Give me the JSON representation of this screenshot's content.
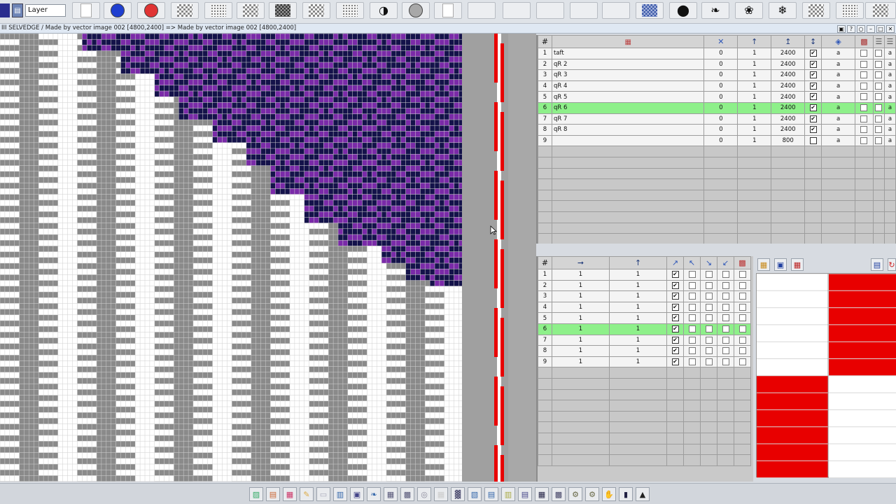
{
  "toolbar": {
    "layer_label": "Layer",
    "buttons": [
      {
        "icon": "blank-page-icon"
      },
      {
        "icon": "blue-circle-icon",
        "color": "#1f3fd0"
      },
      {
        "icon": "red-circle-icon",
        "color": "#e03434"
      },
      {
        "icon": "pattern-grid-icon"
      },
      {
        "icon": "pattern-dots-icon"
      },
      {
        "icon": "pattern-lattice-icon"
      },
      {
        "icon": "pattern-dark-icon"
      },
      {
        "icon": "pattern-weave-icon"
      },
      {
        "icon": "pattern-fine-icon"
      },
      {
        "icon": "pattern-swirl-icon"
      },
      {
        "icon": "gray-circle-icon",
        "color": "#a8a8a8"
      },
      {
        "icon": "blank-swatch-icon"
      },
      {
        "icon": "empty-slot-icon"
      },
      {
        "icon": "empty-slot-icon"
      },
      {
        "icon": "empty-slot-icon"
      },
      {
        "icon": "empty-slot-icon"
      },
      {
        "icon": "empty-slot-icon"
      },
      {
        "icon": "pattern-blue-icon"
      },
      {
        "icon": "black-blob-icon"
      },
      {
        "icon": "butterfly-icon"
      },
      {
        "icon": "flower-icon"
      },
      {
        "icon": "snowflake-icon"
      },
      {
        "icon": "pattern-checker-icon"
      },
      {
        "icon": "pattern-lace-icon"
      },
      {
        "icon": "pattern-ring-icon"
      }
    ]
  },
  "titlebar": {
    "text": "III  SELVEDGE / Made by vector image 002 [4800,2400] => Made by vector image 002 [4800,2400]"
  },
  "colors": {
    "purple": "#7a2aa8",
    "navy": "#14124a",
    "gray": "#8a8a8a",
    "white": "#ffffff",
    "red": "#e80000",
    "selected_row": "#8ef08a"
  },
  "yarn_table": {
    "headers": {
      "num": "#"
    },
    "rows": [
      {
        "num": "1",
        "name": "taft",
        "c1": "0",
        "c2": "1",
        "c3": "2400",
        "checked": true,
        "a": "a",
        "b": "a"
      },
      {
        "num": "2",
        "name": "qR 2",
        "c1": "0",
        "c2": "1",
        "c3": "2400",
        "checked": true,
        "a": "a",
        "b": "a"
      },
      {
        "num": "3",
        "name": "qR 3",
        "c1": "0",
        "c2": "1",
        "c3": "2400",
        "checked": true,
        "a": "a",
        "b": "a"
      },
      {
        "num": "4",
        "name": "qR 4",
        "c1": "0",
        "c2": "1",
        "c3": "2400",
        "checked": true,
        "a": "a",
        "b": "a"
      },
      {
        "num": "5",
        "name": "qR 5",
        "c1": "0",
        "c2": "1",
        "c3": "2400",
        "checked": true,
        "a": "a",
        "b": "a"
      },
      {
        "num": "6",
        "name": "qR 6",
        "c1": "0",
        "c2": "1",
        "c3": "2400",
        "checked": true,
        "a": "a",
        "b": "a",
        "selected": true
      },
      {
        "num": "7",
        "name": "qR 7",
        "c1": "0",
        "c2": "1",
        "c3": "2400",
        "checked": true,
        "a": "a",
        "b": "a"
      },
      {
        "num": "8",
        "name": "qR 8",
        "c1": "0",
        "c2": "1",
        "c3": "2400",
        "checked": true,
        "a": "a",
        "b": "a"
      },
      {
        "num": "9",
        "name": "",
        "c1": "0",
        "c2": "1",
        "c3": "800",
        "checked": false,
        "a": "a",
        "b": "a"
      }
    ]
  },
  "order_table": {
    "headers": {
      "num": "#"
    },
    "rows": [
      {
        "num": "1",
        "c1": "1",
        "c2": "1",
        "checked": true
      },
      {
        "num": "2",
        "c1": "1",
        "c2": "1",
        "checked": true
      },
      {
        "num": "3",
        "c1": "1",
        "c2": "1",
        "checked": true
      },
      {
        "num": "4",
        "c1": "1",
        "c2": "1",
        "checked": true
      },
      {
        "num": "5",
        "c1": "1",
        "c2": "1",
        "checked": true
      },
      {
        "num": "6",
        "c1": "1",
        "c2": "1",
        "checked": true,
        "selected": true
      },
      {
        "num": "7",
        "c1": "1",
        "c2": "1",
        "checked": true
      },
      {
        "num": "8",
        "c1": "1",
        "c2": "1",
        "checked": true
      },
      {
        "num": "9",
        "c1": "1",
        "c2": "1",
        "checked": true
      }
    ]
  },
  "bottom_tools": [
    "layer-icon",
    "color-bars-icon",
    "grid-color-icon",
    "pencil-icon",
    "eraser-icon",
    "split-icon",
    "film-icon",
    "brush-icon",
    "weave-icon",
    "pattern-icon",
    "zoom-icon",
    "mesh-icon",
    "bars-icon",
    "chart-icon",
    "tool-icon",
    "tool2-icon",
    "stack-icon",
    "grid-icon",
    "mesh2-icon",
    "gear-icon",
    "gear2-icon",
    "hand-icon",
    "panel-icon",
    "arrow-up-icon"
  ]
}
